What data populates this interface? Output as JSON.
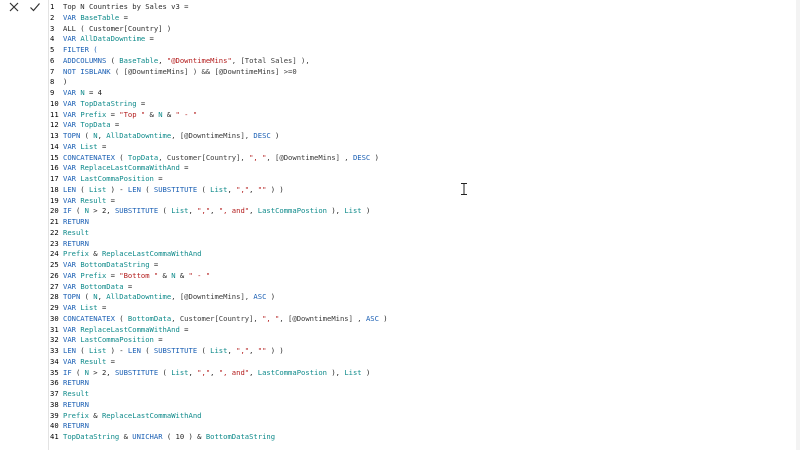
{
  "toolbar": {
    "cancel_icon": "close-icon",
    "commit_icon": "check-icon"
  },
  "lines": [
    {
      "n": "1",
      "parts": [
        {
          "t": "Top N Countries by Sales v3 =",
          "c": "fn"
        }
      ]
    },
    {
      "n": "2",
      "parts": [
        {
          "t": "VAR ",
          "c": "kw"
        },
        {
          "t": "BaseTable",
          "c": "id"
        },
        {
          "t": " =",
          "c": "sym"
        }
      ]
    },
    {
      "n": "3",
      "parts": [
        {
          "t": "ALL ( Customer[Country] )",
          "c": "fn"
        }
      ]
    },
    {
      "n": "4",
      "parts": [
        {
          "t": "VAR ",
          "c": "kw"
        },
        {
          "t": "AllDataDowntime",
          "c": "id"
        },
        {
          "t": " =",
          "c": "sym"
        }
      ]
    },
    {
      "n": "5",
      "parts": [
        {
          "t": "FILTER (",
          "c": "kw"
        }
      ]
    },
    {
      "n": "6",
      "parts": [
        {
          "t": "ADDCOLUMNS",
          "c": "kw"
        },
        {
          "t": " ( ",
          "c": "sym"
        },
        {
          "t": "BaseTable",
          "c": "id"
        },
        {
          "t": ", ",
          "c": "sym"
        },
        {
          "t": "\"@DowntimeMins\"",
          "c": "str"
        },
        {
          "t": ", [Total Sales] ),",
          "c": "fld"
        }
      ]
    },
    {
      "n": "7",
      "parts": [
        {
          "t": "NOT ISBLANK",
          "c": "kw"
        },
        {
          "t": " ( [@DowntimeMins] ) && [@DowntimeMins] >=0",
          "c": "fld"
        }
      ]
    },
    {
      "n": "8",
      "parts": [
        {
          "t": ")",
          "c": "sym"
        }
      ]
    },
    {
      "n": "9",
      "parts": [
        {
          "t": "VAR ",
          "c": "kw"
        },
        {
          "t": "N",
          "c": "id"
        },
        {
          "t": " = 4",
          "c": "sym"
        }
      ]
    },
    {
      "n": "10",
      "parts": [
        {
          "t": "VAR ",
          "c": "kw"
        },
        {
          "t": "TopDataString",
          "c": "id"
        },
        {
          "t": " =",
          "c": "sym"
        }
      ]
    },
    {
      "n": "11",
      "parts": [
        {
          "t": "VAR ",
          "c": "kw"
        },
        {
          "t": "Prefix",
          "c": "id"
        },
        {
          "t": " = ",
          "c": "sym"
        },
        {
          "t": "\"Top \"",
          "c": "str"
        },
        {
          "t": " & ",
          "c": "sym"
        },
        {
          "t": "N",
          "c": "id"
        },
        {
          "t": " & ",
          "c": "sym"
        },
        {
          "t": "\" - \"",
          "c": "str"
        }
      ]
    },
    {
      "n": "12",
      "parts": [
        {
          "t": "VAR ",
          "c": "kw"
        },
        {
          "t": "TopData",
          "c": "id"
        },
        {
          "t": " =",
          "c": "sym"
        }
      ]
    },
    {
      "n": "13",
      "parts": [
        {
          "t": "TOPN",
          "c": "kw"
        },
        {
          "t": " ( ",
          "c": "sym"
        },
        {
          "t": "N",
          "c": "id"
        },
        {
          "t": ", ",
          "c": "sym"
        },
        {
          "t": "AllDataDowntime",
          "c": "id"
        },
        {
          "t": ", [@DowntimeMins], ",
          "c": "fld"
        },
        {
          "t": "DESC",
          "c": "kw"
        },
        {
          "t": " )",
          "c": "sym"
        }
      ]
    },
    {
      "n": "14",
      "parts": [
        {
          "t": "VAR ",
          "c": "kw"
        },
        {
          "t": "List",
          "c": "id"
        },
        {
          "t": " =",
          "c": "sym"
        }
      ]
    },
    {
      "n": "15",
      "parts": [
        {
          "t": "CONCATENATEX",
          "c": "kw"
        },
        {
          "t": " ( ",
          "c": "sym"
        },
        {
          "t": "TopData",
          "c": "id"
        },
        {
          "t": ", Customer[Country], ",
          "c": "fld"
        },
        {
          "t": "\", \"",
          "c": "str"
        },
        {
          "t": ", [@DowntimeMins] , ",
          "c": "fld"
        },
        {
          "t": "DESC",
          "c": "kw"
        },
        {
          "t": " )",
          "c": "sym"
        }
      ]
    },
    {
      "n": "16",
      "parts": [
        {
          "t": "VAR ",
          "c": "kw"
        },
        {
          "t": "ReplaceLastCommaWithAnd",
          "c": "id"
        },
        {
          "t": " =",
          "c": "sym"
        }
      ]
    },
    {
      "n": "17",
      "parts": [
        {
          "t": "VAR ",
          "c": "kw"
        },
        {
          "t": "LastCommaPosition",
          "c": "id"
        },
        {
          "t": " =",
          "c": "sym"
        }
      ]
    },
    {
      "n": "18",
      "parts": [
        {
          "t": "LEN",
          "c": "kw"
        },
        {
          "t": " ( ",
          "c": "sym"
        },
        {
          "t": "List",
          "c": "id"
        },
        {
          "t": " ) - ",
          "c": "sym"
        },
        {
          "t": "LEN",
          "c": "kw"
        },
        {
          "t": " ( ",
          "c": "sym"
        },
        {
          "t": "SUBSTITUTE",
          "c": "kw"
        },
        {
          "t": " ( ",
          "c": "sym"
        },
        {
          "t": "List",
          "c": "id"
        },
        {
          "t": ", ",
          "c": "sym"
        },
        {
          "t": "\",\"",
          "c": "str"
        },
        {
          "t": ", ",
          "c": "sym"
        },
        {
          "t": "\"\"",
          "c": "str"
        },
        {
          "t": " ) )",
          "c": "sym"
        }
      ]
    },
    {
      "n": "19",
      "parts": [
        {
          "t": "VAR ",
          "c": "kw"
        },
        {
          "t": "Result",
          "c": "id"
        },
        {
          "t": " =",
          "c": "sym"
        }
      ]
    },
    {
      "n": "20",
      "parts": [
        {
          "t": "IF",
          "c": "kw"
        },
        {
          "t": " ( ",
          "c": "sym"
        },
        {
          "t": "N",
          "c": "id"
        },
        {
          "t": " > 2, ",
          "c": "sym"
        },
        {
          "t": "SUBSTITUTE",
          "c": "kw"
        },
        {
          "t": " ( ",
          "c": "sym"
        },
        {
          "t": "List",
          "c": "id"
        },
        {
          "t": ", ",
          "c": "sym"
        },
        {
          "t": "\",\"",
          "c": "str"
        },
        {
          "t": ", ",
          "c": "sym"
        },
        {
          "t": "\", and\"",
          "c": "str"
        },
        {
          "t": ", ",
          "c": "sym"
        },
        {
          "t": "LastCommaPostion",
          "c": "id"
        },
        {
          "t": " ), ",
          "c": "sym"
        },
        {
          "t": "List",
          "c": "id"
        },
        {
          "t": " )",
          "c": "sym"
        }
      ]
    },
    {
      "n": "21",
      "parts": [
        {
          "t": "RETURN",
          "c": "kw"
        }
      ]
    },
    {
      "n": "22",
      "parts": [
        {
          "t": "Result",
          "c": "id"
        }
      ]
    },
    {
      "n": "23",
      "parts": [
        {
          "t": "RETURN",
          "c": "kw"
        }
      ]
    },
    {
      "n": "24",
      "parts": [
        {
          "t": "Prefix",
          "c": "id"
        },
        {
          "t": " & ",
          "c": "sym"
        },
        {
          "t": "ReplaceLastCommaWithAnd",
          "c": "id"
        }
      ]
    },
    {
      "n": "25",
      "parts": [
        {
          "t": "VAR ",
          "c": "kw"
        },
        {
          "t": "BottomDataString",
          "c": "id"
        },
        {
          "t": " =",
          "c": "sym"
        }
      ]
    },
    {
      "n": "26",
      "parts": [
        {
          "t": "VAR ",
          "c": "kw"
        },
        {
          "t": "Prefix",
          "c": "id"
        },
        {
          "t": " = ",
          "c": "sym"
        },
        {
          "t": "\"Bottom \"",
          "c": "str"
        },
        {
          "t": " & ",
          "c": "sym"
        },
        {
          "t": "N",
          "c": "id"
        },
        {
          "t": " & ",
          "c": "sym"
        },
        {
          "t": "\" - \"",
          "c": "str"
        }
      ]
    },
    {
      "n": "27",
      "parts": [
        {
          "t": "VAR ",
          "c": "kw"
        },
        {
          "t": "BottomData",
          "c": "id"
        },
        {
          "t": " =",
          "c": "sym"
        }
      ]
    },
    {
      "n": "28",
      "parts": [
        {
          "t": "TOPN",
          "c": "kw"
        },
        {
          "t": " ( ",
          "c": "sym"
        },
        {
          "t": "N",
          "c": "id"
        },
        {
          "t": ", ",
          "c": "sym"
        },
        {
          "t": "AllDataDowntime",
          "c": "id"
        },
        {
          "t": ", [@DowntimeMins], ",
          "c": "fld"
        },
        {
          "t": "ASC",
          "c": "kw"
        },
        {
          "t": " )",
          "c": "sym"
        }
      ]
    },
    {
      "n": "29",
      "parts": [
        {
          "t": "VAR ",
          "c": "kw"
        },
        {
          "t": "List",
          "c": "id"
        },
        {
          "t": " =",
          "c": "sym"
        }
      ]
    },
    {
      "n": "30",
      "parts": [
        {
          "t": "CONCATENATEX",
          "c": "kw"
        },
        {
          "t": " ( ",
          "c": "sym"
        },
        {
          "t": "BottomData",
          "c": "id"
        },
        {
          "t": ", Customer[Country], ",
          "c": "fld"
        },
        {
          "t": "\", \"",
          "c": "str"
        },
        {
          "t": ", [@DowntimeMins] , ",
          "c": "fld"
        },
        {
          "t": "ASC",
          "c": "kw"
        },
        {
          "t": " )",
          "c": "sym"
        }
      ]
    },
    {
      "n": "31",
      "parts": [
        {
          "t": "VAR ",
          "c": "kw"
        },
        {
          "t": "ReplaceLastCommaWithAnd",
          "c": "id"
        },
        {
          "t": " =",
          "c": "sym"
        }
      ]
    },
    {
      "n": "32",
      "parts": [
        {
          "t": "VAR ",
          "c": "kw"
        },
        {
          "t": "LastCommaPosition",
          "c": "id"
        },
        {
          "t": " =",
          "c": "sym"
        }
      ]
    },
    {
      "n": "33",
      "parts": [
        {
          "t": "LEN",
          "c": "kw"
        },
        {
          "t": " ( ",
          "c": "sym"
        },
        {
          "t": "List",
          "c": "id"
        },
        {
          "t": " ) - ",
          "c": "sym"
        },
        {
          "t": "LEN",
          "c": "kw"
        },
        {
          "t": " ( ",
          "c": "sym"
        },
        {
          "t": "SUBSTITUTE",
          "c": "kw"
        },
        {
          "t": " ( ",
          "c": "sym"
        },
        {
          "t": "List",
          "c": "id"
        },
        {
          "t": ", ",
          "c": "sym"
        },
        {
          "t": "\",\"",
          "c": "str"
        },
        {
          "t": ", ",
          "c": "sym"
        },
        {
          "t": "\"\"",
          "c": "str"
        },
        {
          "t": " ) )",
          "c": "sym"
        }
      ]
    },
    {
      "n": "34",
      "parts": [
        {
          "t": "VAR ",
          "c": "kw"
        },
        {
          "t": "Result",
          "c": "id"
        },
        {
          "t": " =",
          "c": "sym"
        }
      ]
    },
    {
      "n": "35",
      "parts": [
        {
          "t": "IF",
          "c": "kw"
        },
        {
          "t": " ( ",
          "c": "sym"
        },
        {
          "t": "N",
          "c": "id"
        },
        {
          "t": " > 2, ",
          "c": "sym"
        },
        {
          "t": "SUBSTITUTE",
          "c": "kw"
        },
        {
          "t": " ( ",
          "c": "sym"
        },
        {
          "t": "List",
          "c": "id"
        },
        {
          "t": ", ",
          "c": "sym"
        },
        {
          "t": "\",\"",
          "c": "str"
        },
        {
          "t": ", ",
          "c": "sym"
        },
        {
          "t": "\", and\"",
          "c": "str"
        },
        {
          "t": ", ",
          "c": "sym"
        },
        {
          "t": "LastCommaPostion",
          "c": "id"
        },
        {
          "t": " ), ",
          "c": "sym"
        },
        {
          "t": "List",
          "c": "id"
        },
        {
          "t": " )",
          "c": "sym"
        }
      ]
    },
    {
      "n": "36",
      "parts": [
        {
          "t": "RETURN",
          "c": "kw"
        }
      ]
    },
    {
      "n": "37",
      "parts": [
        {
          "t": "Result",
          "c": "id"
        }
      ]
    },
    {
      "n": "38",
      "parts": [
        {
          "t": "RETURN",
          "c": "kw"
        }
      ]
    },
    {
      "n": "39",
      "parts": [
        {
          "t": "Prefix",
          "c": "id"
        },
        {
          "t": " & ",
          "c": "sym"
        },
        {
          "t": "ReplaceLastCommaWithAnd",
          "c": "id"
        }
      ]
    },
    {
      "n": "40",
      "parts": [
        {
          "t": "RETURN",
          "c": "kw"
        }
      ]
    },
    {
      "n": "41",
      "parts": [
        {
          "t": "TopDataString",
          "c": "id"
        },
        {
          "t": " & ",
          "c": "sym"
        },
        {
          "t": "UNICHAR",
          "c": "kw"
        },
        {
          "t": " ( 10 ) & ",
          "c": "sym"
        },
        {
          "t": "BottomDataString",
          "c": "id"
        }
      ]
    }
  ]
}
